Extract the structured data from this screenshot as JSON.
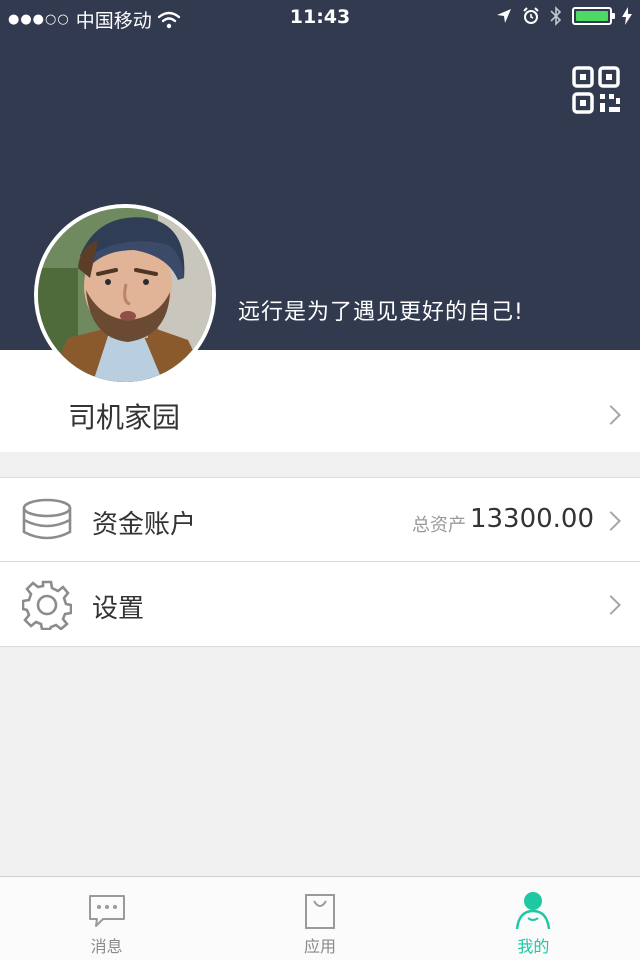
{
  "status_bar": {
    "signal": "●●●○○",
    "carrier": "中国移动",
    "time": "11:43"
  },
  "header": {
    "motto": "远行是为了遇见更好的自己!"
  },
  "profile": {
    "name": "司机家园"
  },
  "menu": {
    "account_label": "资金账户",
    "asset_caption": "总资产",
    "asset_value": "13300.00",
    "settings_label": "设置"
  },
  "tabs": [
    {
      "label": "消息",
      "icon": "message-icon"
    },
    {
      "label": "应用",
      "icon": "bag-icon"
    },
    {
      "label": "我的",
      "icon": "person-icon",
      "active": true
    }
  ],
  "colors": {
    "header_bg": "#313a4e",
    "accent": "#1fc7a3",
    "battery": "#4cd964"
  }
}
